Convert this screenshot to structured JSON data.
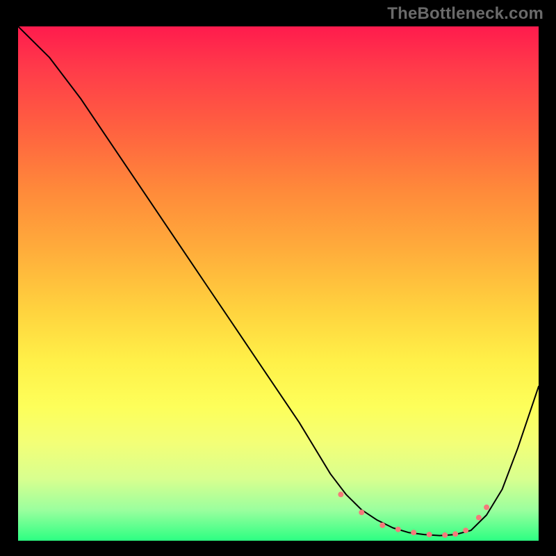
{
  "watermark": "TheBottleneck.com",
  "chart_data": {
    "type": "line",
    "title": "",
    "xlabel": "",
    "ylabel": "",
    "xlim": [
      0,
      100
    ],
    "ylim": [
      0,
      100
    ],
    "grid": false,
    "curve_description": "Bottleneck-style V curve: steep descending line from top-left, flattening into a shallow trough around x≈70–85, rising again toward the right edge",
    "x": [
      0,
      6,
      12,
      18,
      24,
      30,
      36,
      42,
      48,
      54,
      60,
      63,
      66,
      69,
      72,
      75,
      78,
      81,
      84,
      87,
      90,
      93,
      96,
      100
    ],
    "values": [
      100,
      94,
      86,
      77,
      68,
      59,
      50,
      41,
      32,
      23,
      13,
      9,
      6,
      4,
      2.5,
      1.6,
      1.2,
      1.0,
      1.2,
      2.0,
      5,
      10,
      18,
      30
    ],
    "markers": {
      "description": "Cluster of coral dots along the trough and start of the right upswing",
      "x": [
        62,
        66,
        70,
        73,
        76,
        79,
        82,
        84,
        86,
        88.5,
        90
      ],
      "y": [
        9,
        5.5,
        3,
        2.2,
        1.6,
        1.2,
        1.1,
        1.3,
        2.0,
        4.5,
        6.5
      ],
      "color": "#f47a7a",
      "radius": 4
    },
    "colors": {
      "background_top": "#ff1b4d",
      "background_bottom": "#2cff82",
      "line": "#000000",
      "frame": "#000000"
    }
  }
}
